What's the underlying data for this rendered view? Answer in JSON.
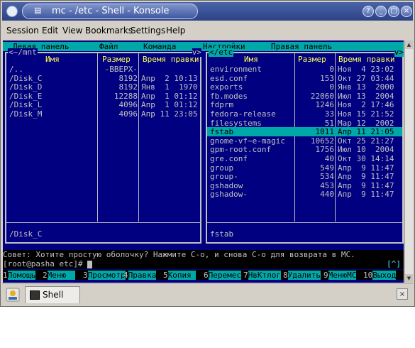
{
  "window": {
    "title": "mc - /etc - Shell - Konsole",
    "buttons": {
      "help": "?",
      "minimize": "_",
      "maximize": "□",
      "close": "×"
    }
  },
  "menubar": [
    "Session",
    "Edit",
    "View",
    "Bookmarks",
    "Settings",
    "Help"
  ],
  "mc_menu": [
    "Левая панель",
    "Файл",
    "Команда",
    "Настройки",
    "Правая панель"
  ],
  "left_panel": {
    "path": "<~/mnt",
    "corner": "v>",
    "headers": {
      "name": "Имя",
      "size": "Размер",
      "time": "Время правки"
    },
    "rows": [
      {
        "name": "/..",
        "size": "-ВВЕРХ-",
        "time": ""
      },
      {
        "name": "/Disk_C",
        "size": "8192",
        "time": "Апр  2 10:13"
      },
      {
        "name": "/Disk_D",
        "size": "8192",
        "time": "Янв  1  1970"
      },
      {
        "name": "/Disk_E",
        "size": "12288",
        "time": "Апр  1 01:12"
      },
      {
        "name": "/Disk_L",
        "size": "4096",
        "time": "Апр  1 01:12"
      },
      {
        "name": "/Disk_M",
        "size": "4096",
        "time": "Апр 11 23:05"
      }
    ],
    "status": "/Disk_C"
  },
  "right_panel": {
    "path": "</etc",
    "corner": "v>",
    "headers": {
      "name": "Имя",
      "size": "Размер",
      "time": "Время правки"
    },
    "rows": [
      {
        "name": "environment",
        "size": "0",
        "time": "Ноя  4 23:02",
        "selected": false
      },
      {
        "name": "esd.conf",
        "size": "153",
        "time": "Окт 27 03:44",
        "selected": false
      },
      {
        "name": "exports",
        "size": "0",
        "time": "Янв 13  2000",
        "selected": false
      },
      {
        "name": "fb.modes",
        "size": "22060",
        "time": "Июл 13  2004",
        "selected": false
      },
      {
        "name": "fdprm",
        "size": "1246",
        "time": "Ноя  2 17:46",
        "selected": false
      },
      {
        "name": "fedora-release",
        "size": "33",
        "time": "Ноя 15 21:52",
        "selected": false
      },
      {
        "name": "filesystems",
        "size": "51",
        "time": "Мар 12  2002",
        "selected": false
      },
      {
        "name": "fstab",
        "size": "1011",
        "time": "Апр 11 21:05",
        "selected": true
      },
      {
        "name": "gnome-vf~e-magic",
        "size": "10652",
        "time": "Окт 25 21:27",
        "selected": false
      },
      {
        "name": "gpm-root.conf",
        "size": "1756",
        "time": "Июл 10  2004",
        "selected": false
      },
      {
        "name": "gre.conf",
        "size": "40",
        "time": "Окт 30 14:14",
        "selected": false
      },
      {
        "name": "group",
        "size": "549",
        "time": "Апр  9 11:47",
        "selected": false
      },
      {
        "name": "group-",
        "size": "534",
        "time": "Апр  9 11:47",
        "selected": false
      },
      {
        "name": "gshadow",
        "size": "453",
        "time": "Апр  9 11:47",
        "selected": false
      },
      {
        "name": "gshadow-",
        "size": "440",
        "time": "Апр  9 11:47",
        "selected": false
      }
    ],
    "status": "fstab"
  },
  "hint": "Совет: Хотите простую оболочку? Нажмите C-o, и снова C-o для возврата в MC.",
  "prompt": "[root@pasha etc]# ",
  "prompt_bracket": "[^]",
  "fkeys": [
    {
      "num": "1",
      "label": "Помощь"
    },
    {
      "num": "2",
      "label": "Меню  "
    },
    {
      "num": "3",
      "label": "Просмотр"
    },
    {
      "num": "4",
      "label": "Правка"
    },
    {
      "num": "5",
      "label": "Копия "
    },
    {
      "num": "6",
      "label": "Перемес"
    },
    {
      "num": "7",
      "label": "НвКтлог"
    },
    {
      "num": "8",
      "label": "Удалить"
    },
    {
      "num": "9",
      "label": "МенюМС"
    },
    {
      "num": "10",
      "label": "Выход"
    }
  ],
  "tabbar": {
    "tab_label": "Shell",
    "close": "×"
  }
}
